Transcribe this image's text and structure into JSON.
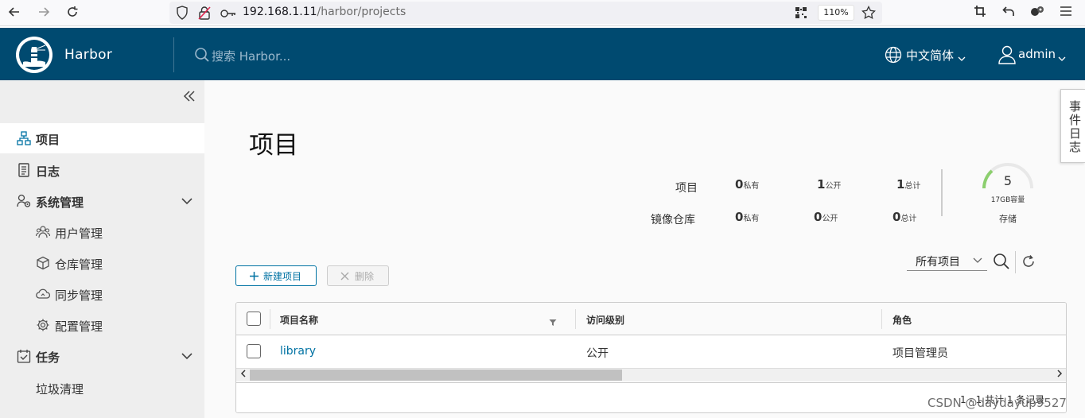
{
  "browser": {
    "url_host": "192.168.1.11",
    "url_path": "/harbor/projects",
    "zoom": "110%"
  },
  "header": {
    "brand": "Harbor",
    "search_placeholder": "搜索 Harbor...",
    "language": "中文简体",
    "user": "admin"
  },
  "sidebar": {
    "items": [
      {
        "label": "项目"
      },
      {
        "label": "日志"
      },
      {
        "label": "系统管理"
      },
      {
        "label": "用户管理"
      },
      {
        "label": "仓库管理"
      },
      {
        "label": "同步管理"
      },
      {
        "label": "配置管理"
      },
      {
        "label": "任务"
      },
      {
        "label": "垃圾清理"
      }
    ]
  },
  "main": {
    "title": "项目",
    "stats": {
      "rows": [
        {
          "label": "项目",
          "private": "0",
          "public": "1",
          "total": "1"
        },
        {
          "label": "镜像仓库",
          "private": "0",
          "public": "0",
          "total": "0"
        }
      ],
      "private_suffix": "私有",
      "public_suffix": "公开",
      "total_suffix": "总计",
      "storage_value": "5",
      "storage_capacity": "17GB容量",
      "storage_label": "存储"
    },
    "buttons": {
      "new_project": "新建项目",
      "delete": "删除"
    },
    "filter": "所有项目",
    "table": {
      "headers": [
        "项目名称",
        "访问级别",
        "角色"
      ],
      "rows": [
        {
          "name": "library",
          "access": "公开",
          "role": "项目管理员"
        }
      ],
      "footer": "1 - 1 共计 1 条记录"
    }
  },
  "event_tab": "事件日志",
  "watermark": "CSDN @daydayup9527",
  "colors": {
    "header_bg": "#004a70",
    "accent": "#0072a3",
    "gauge": "#8ccf6e"
  }
}
